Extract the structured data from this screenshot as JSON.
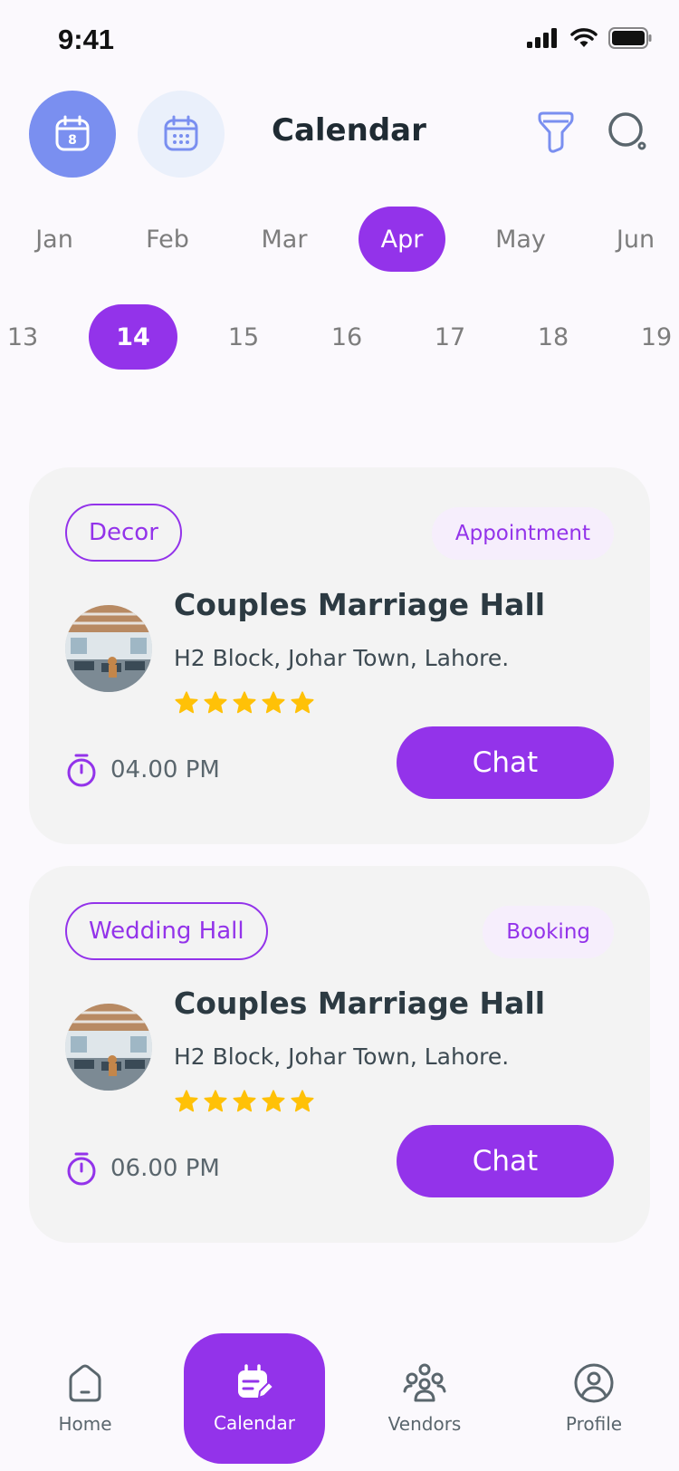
{
  "status_bar": {
    "time": "9:41"
  },
  "header": {
    "title": "Calendar"
  },
  "months": [
    "Jan",
    "Feb",
    "Mar",
    "Apr",
    "May",
    "Jun"
  ],
  "selected_month": "Apr",
  "days": [
    "13",
    "14",
    "15",
    "16",
    "17",
    "18",
    "19"
  ],
  "selected_day": "14",
  "cards": [
    {
      "tag": "Decor",
      "type": "Appointment",
      "name": "Couples Marriage Hall",
      "address": "H2 Block, Johar Town, Lahore.",
      "rating": 5,
      "time": "04.00 PM",
      "action": "Chat"
    },
    {
      "tag": "Wedding Hall",
      "type": "Booking",
      "name": "Couples Marriage Hall",
      "address": "H2 Block, Johar Town, Lahore.",
      "rating": 5,
      "time": "06.00 PM",
      "action": "Chat"
    }
  ],
  "nav": {
    "home": "Home",
    "calendar": "Calendar",
    "vendors": "Vendors",
    "profile": "Profile"
  },
  "colors": {
    "accent": "#9333ea",
    "star": "#ffc107",
    "active_header_button": "#7a8ff0"
  }
}
